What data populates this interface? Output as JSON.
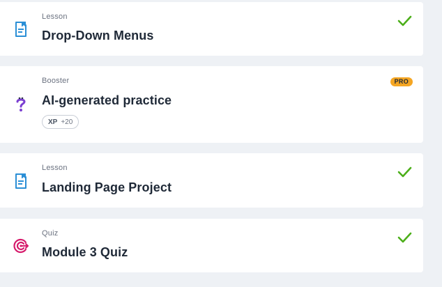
{
  "items": [
    {
      "type": "Lesson",
      "title": "Drop-Down Menus",
      "icon": "lesson-icon",
      "completed": true
    },
    {
      "type": "Booster",
      "title": "AI-generated practice",
      "icon": "question-icon",
      "badge": "PRO",
      "xp_label": "XP",
      "xp_value": "+20",
      "completed": false
    },
    {
      "type": "Lesson",
      "title": "Landing Page Project",
      "icon": "lesson-icon",
      "completed": true
    },
    {
      "type": "Quiz",
      "title": "Module 3 Quiz",
      "icon": "target-icon",
      "completed": true
    }
  ],
  "colors": {
    "background": "#eef1f5",
    "card": "#ffffff",
    "check": "#4caf1a",
    "lesson_icon": "#2b8fd6",
    "question_icon": "#7b3fd1",
    "target_icon": "#d61a6b",
    "pro_badge": "#f5a623"
  }
}
